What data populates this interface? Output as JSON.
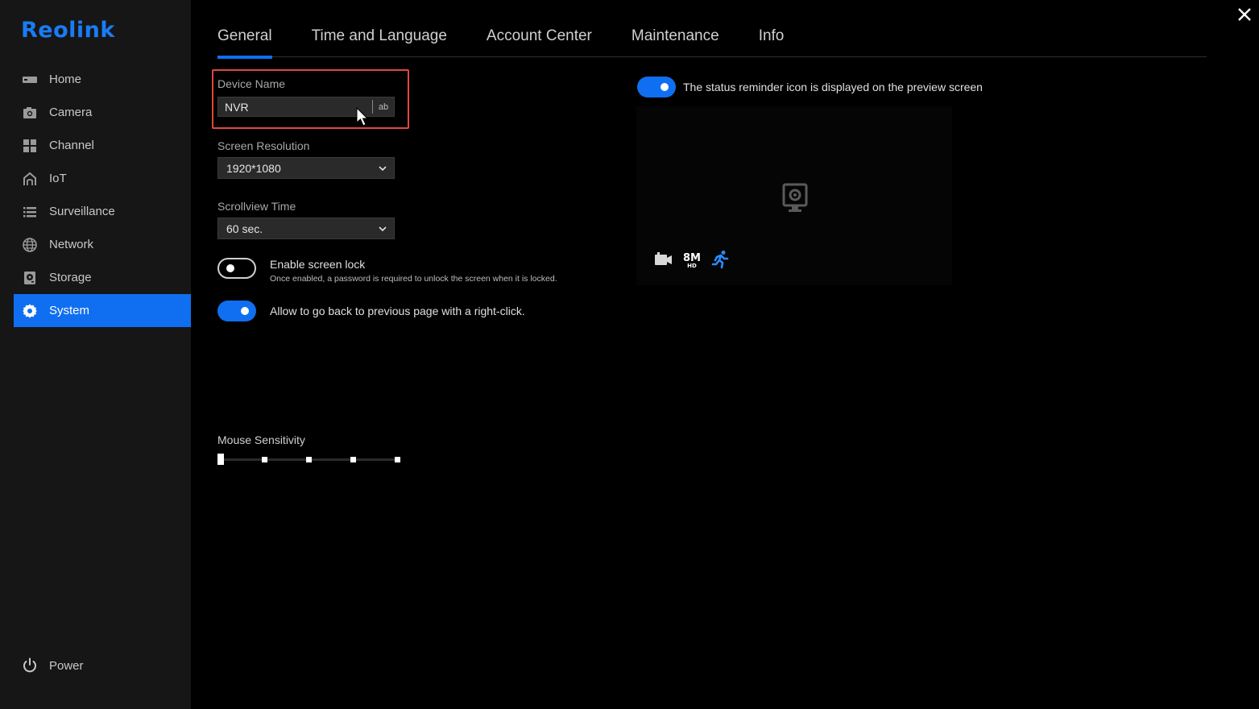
{
  "brand": {
    "logo_text": "Reolink",
    "accent": "#0f6ff0",
    "highlight": "#e0473f"
  },
  "sidebar": {
    "items": [
      {
        "label": "Home",
        "icon": "nvr-box-icon"
      },
      {
        "label": "Camera",
        "icon": "camera-icon"
      },
      {
        "label": "Channel",
        "icon": "grid-icon"
      },
      {
        "label": "IoT",
        "icon": "iot-house-icon"
      },
      {
        "label": "Surveillance",
        "icon": "list-icon"
      },
      {
        "label": "Network",
        "icon": "globe-icon"
      },
      {
        "label": "Storage",
        "icon": "hard-drive-icon"
      },
      {
        "label": "System",
        "icon": "gear-icon",
        "active": true
      }
    ],
    "power_label": "Power"
  },
  "tabs": [
    {
      "label": "General",
      "active": true
    },
    {
      "label": "Time and Language"
    },
    {
      "label": "Account Center"
    },
    {
      "label": "Maintenance"
    },
    {
      "label": "Info"
    }
  ],
  "form": {
    "device_name": {
      "label": "Device Name",
      "value": "NVR",
      "ime_badge": "ab"
    },
    "screen_resolution": {
      "label": "Screen Resolution",
      "value": "1920*1080"
    },
    "scrollview_time": {
      "label": "Scrollview Time",
      "value": "60 sec."
    },
    "screen_lock": {
      "label": "Enable screen lock",
      "description": "Once enabled, a password is required to unlock the screen when it is locked.",
      "enabled": false
    },
    "right_click_back": {
      "label": "Allow to go back to previous page with a right-click.",
      "enabled": true
    },
    "mouse_sensitivity": {
      "label": "Mouse Sensitivity",
      "level": 1,
      "levels": 5
    }
  },
  "preview": {
    "status_reminder": {
      "label": "The status reminder icon is displayed on the preview screen",
      "enabled": true
    },
    "resolution_badge": {
      "top": "8M",
      "bottom": "HD"
    },
    "icons": [
      "camera-placeholder-icon",
      "record-icon",
      "resolution-8m-hd-icon",
      "motion-person-icon"
    ]
  }
}
